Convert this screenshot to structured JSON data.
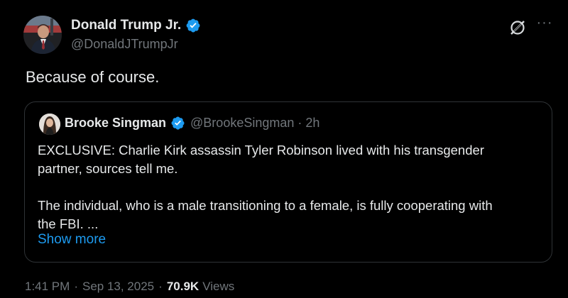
{
  "author": {
    "name": "Donald Trump Jr.",
    "handle": "@DonaldJTrumpJr"
  },
  "post": {
    "text": "Because of course."
  },
  "quote": {
    "name": "Brooke Singman",
    "handle": "@BrookeSingman",
    "dot": "·",
    "time": "2h",
    "line1": "EXCLUSIVE: Charlie Kirk assassin Tyler Robinson lived with his transgender",
    "line2": "partner, sources tell me.",
    "line3": "The individual, who is a male transitioning to a female, is fully cooperating with",
    "line4": "the FBI. ...",
    "show_more": "Show more"
  },
  "meta": {
    "time": "1:41 PM",
    "sep1": "·",
    "date": "Sep 13, 2025",
    "sep2": "·",
    "views_count": "70.9K",
    "views_label": "Views"
  },
  "icons": {
    "verified": "verified-badge-icon",
    "grok": "grok-icon",
    "more": "more-icon"
  },
  "colors": {
    "background": "#000000",
    "text": "#e7e9ea",
    "secondary": "#71767b",
    "accent": "#1d9bf0",
    "border": "#2f3336"
  }
}
